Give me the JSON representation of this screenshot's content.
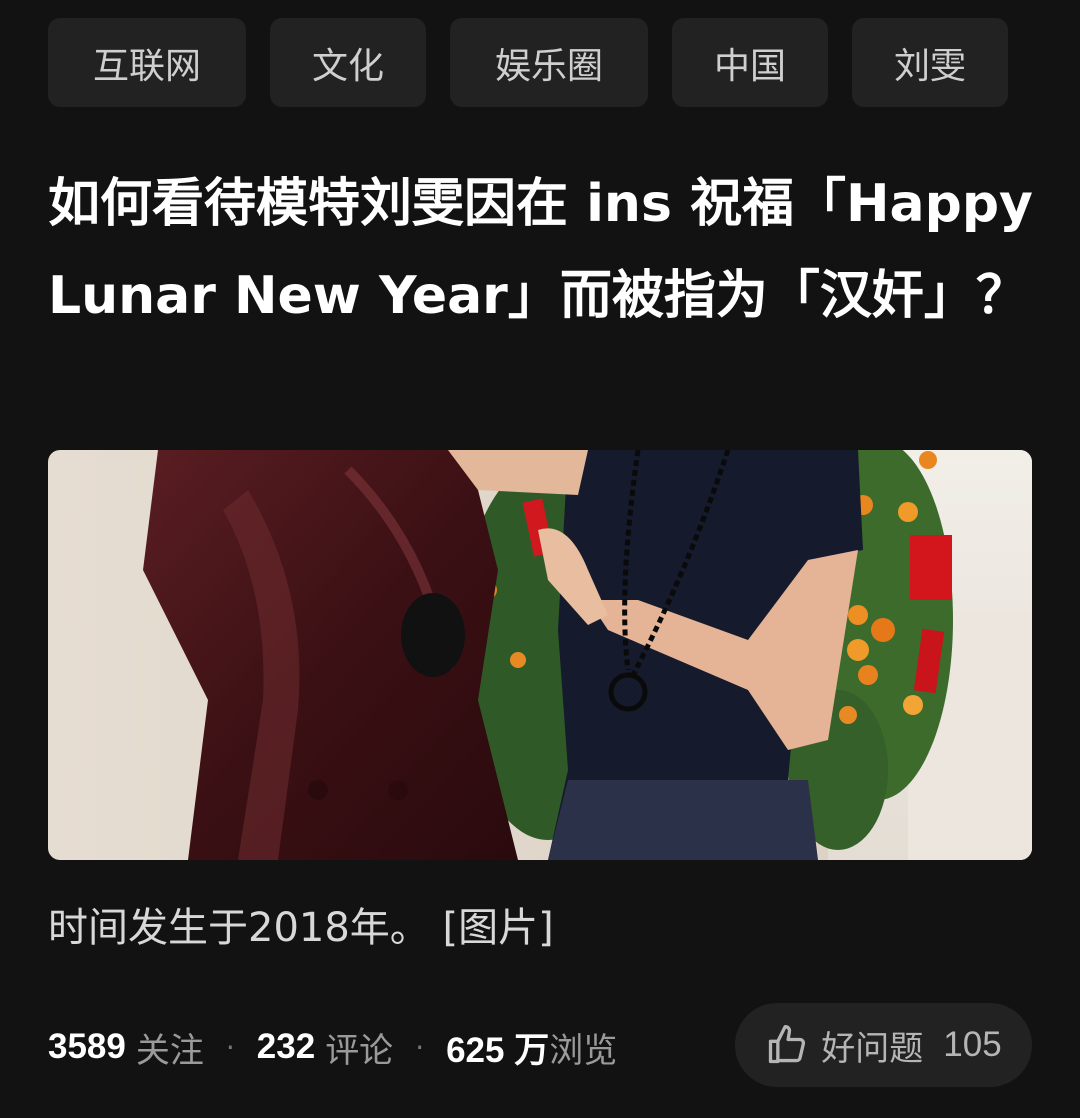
{
  "topics": [
    "互联网",
    "文化",
    "娱乐圈",
    "中国",
    "刘雯"
  ],
  "question": {
    "title": "如何看待模特刘雯因在 ins 祝福「Happy Lunar New Year」而被指为「汉奸」？",
    "description": "时间发生于2018年。",
    "image_link": "[图片]"
  },
  "stats": {
    "followers_count": "3589",
    "followers_label": "关注",
    "comments_count": "232",
    "comments_label": "评论",
    "views_count": "625 万",
    "views_label": "浏览",
    "separator": "·"
  },
  "good_question": {
    "label": "好问题",
    "count": "105",
    "icon": "thumbs-up-icon"
  },
  "colors": {
    "background": "#121212",
    "tag_background": "#222222",
    "text_primary": "#ffffff",
    "text_secondary": "#9a9a9a"
  }
}
